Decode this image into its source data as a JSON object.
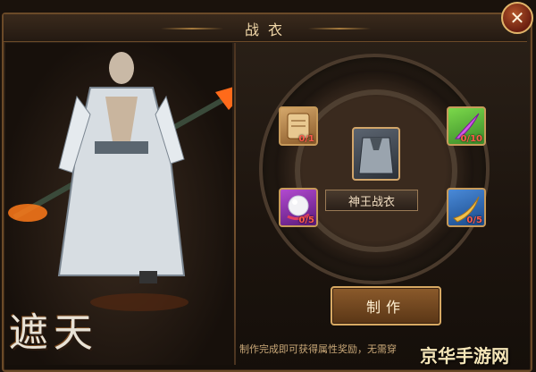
{
  "window": {
    "title": "战衣"
  },
  "close_button": {
    "label": "✕"
  },
  "center_item": {
    "name": "神王战衣"
  },
  "materials": [
    {
      "icon": "scroll-icon",
      "count": "0/1",
      "color": "#b87a3a"
    },
    {
      "icon": "purple-feather-icon",
      "count": "0/10",
      "color": "#9b3bd0"
    },
    {
      "icon": "pearl-icon",
      "count": "0/5",
      "color": "#7a2d8a"
    },
    {
      "icon": "golden-feather-icon",
      "count": "0/5",
      "color": "#2f6fb0"
    }
  ],
  "action": {
    "label": "制作"
  },
  "hint": {
    "text": "制作完成即可获得属性奖励，无需穿"
  },
  "logo": {
    "text": "遮天"
  },
  "watermark": {
    "text": "京华手游网"
  }
}
